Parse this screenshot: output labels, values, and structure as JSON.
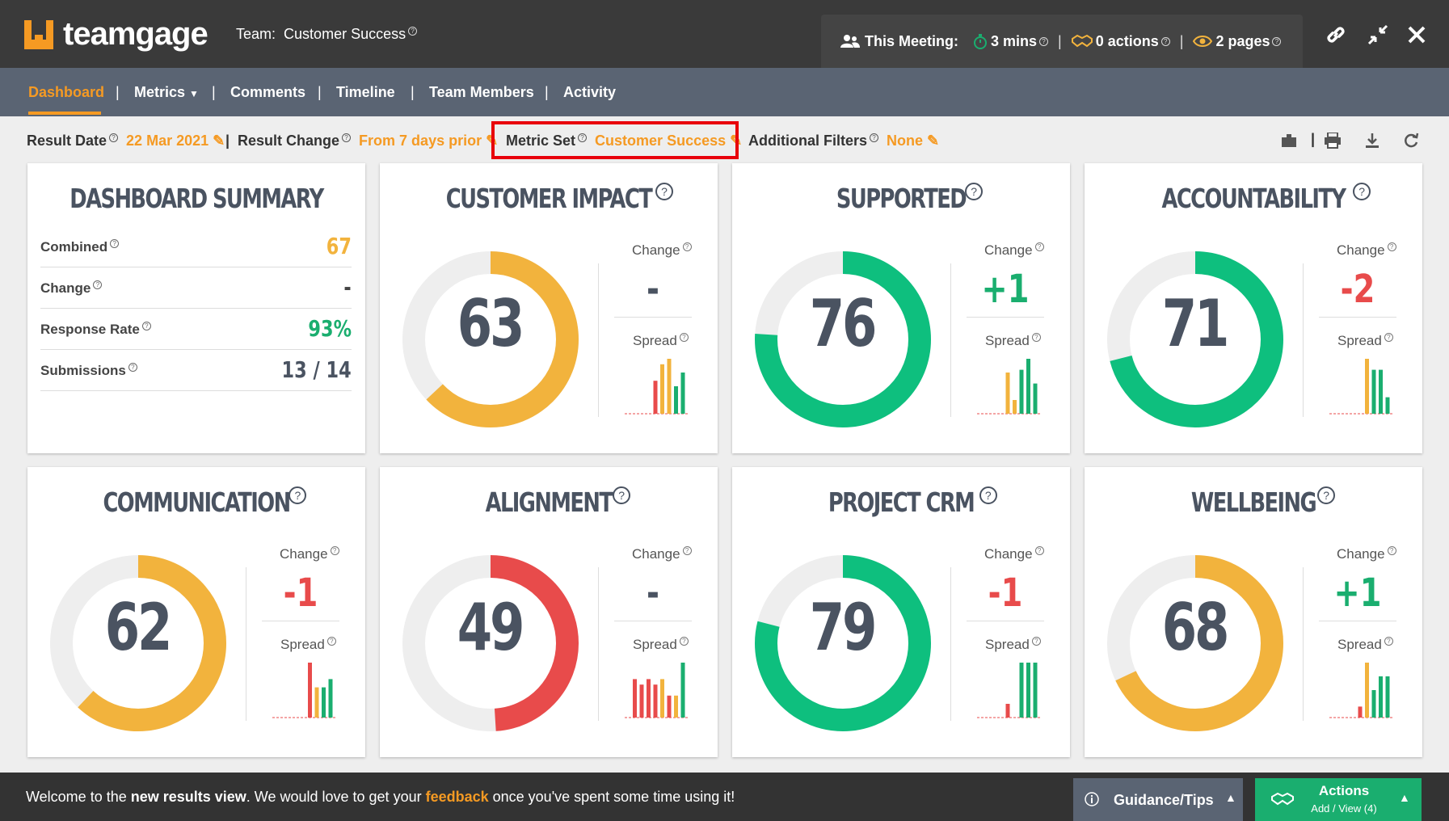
{
  "brand": {
    "name": "teamgage"
  },
  "team": {
    "label": "Team:",
    "name": "Customer Success"
  },
  "meeting": {
    "label": "This Meeting:",
    "time": "3 mins",
    "actions": "0 actions",
    "pages": "2 pages"
  },
  "nav": [
    "Dashboard",
    "Metrics",
    "Comments",
    "Timeline",
    "Team Members",
    "Activity"
  ],
  "filters": {
    "result_date_label": "Result Date",
    "result_date": "22 Mar 2021",
    "result_change_label": "Result Change",
    "result_change": "From 7 days prior",
    "metric_set_label": "Metric Set",
    "metric_set": "Customer Success",
    "additional_filters_label": "Additional Filters",
    "additional_filters": "None"
  },
  "summary": {
    "title": "DASHBOARD SUMMARY",
    "rows": [
      {
        "label": "Combined",
        "value": "67",
        "color": "#f2b33d"
      },
      {
        "label": "Change",
        "value": "-",
        "color": "#444444"
      },
      {
        "label": "Response Rate",
        "value": "93%",
        "color": "#1aae6f"
      },
      {
        "label": "Submissions",
        "value": "13 / 14",
        "color": "#4a5361"
      }
    ]
  },
  "labels": {
    "change": "Change",
    "spread": "Spread"
  },
  "metrics": [
    {
      "title": "CUSTOMER IMPACT",
      "score": "63",
      "change": "-",
      "change_color": "#4a5361",
      "ring_color": "#f2b33d",
      "fraction": 0.63,
      "spread": [
        {
          "v": 0.0,
          "c": "#e84b4b"
        },
        {
          "v": 0.0,
          "c": "#e84b4b"
        },
        {
          "v": 0.0,
          "c": "#e84b4b"
        },
        {
          "v": 0.6,
          "c": "#e84b4b"
        },
        {
          "v": 0.9,
          "c": "#f2b33d"
        },
        {
          "v": 1.0,
          "c": "#f2b33d"
        },
        {
          "v": 0.5,
          "c": "#1aae6f"
        },
        {
          "v": 0.75,
          "c": "#1aae6f"
        }
      ]
    },
    {
      "title": "SUPPORTED",
      "score": "76",
      "change": "+1",
      "change_color": "#1aae6f",
      "ring_color": "#0ebf7e",
      "fraction": 0.76,
      "spread": [
        {
          "v": 0.0,
          "c": "#e84b4b"
        },
        {
          "v": 0.0,
          "c": "#e84b4b"
        },
        {
          "v": 0.0,
          "c": "#e84b4b"
        },
        {
          "v": 0.0,
          "c": "#e84b4b"
        },
        {
          "v": 0.75,
          "c": "#f2b33d"
        },
        {
          "v": 0.25,
          "c": "#f2b33d"
        },
        {
          "v": 0.8,
          "c": "#1aae6f"
        },
        {
          "v": 1.0,
          "c": "#1aae6f"
        },
        {
          "v": 0.55,
          "c": "#1aae6f"
        }
      ]
    },
    {
      "title": "ACCOUNTABILITY",
      "score": "71",
      "change": "-2",
      "change_color": "#e84b4b",
      "ring_color": "#0ebf7e",
      "fraction": 0.71,
      "spread": [
        {
          "v": 0.0,
          "c": "#e84b4b"
        },
        {
          "v": 0.0,
          "c": "#e84b4b"
        },
        {
          "v": 0.0,
          "c": "#e84b4b"
        },
        {
          "v": 0.0,
          "c": "#e84b4b"
        },
        {
          "v": 1.0,
          "c": "#f2b33d"
        },
        {
          "v": 0.8,
          "c": "#1aae6f"
        },
        {
          "v": 0.8,
          "c": "#1aae6f"
        },
        {
          "v": 0.3,
          "c": "#1aae6f"
        }
      ]
    },
    {
      "title": "COMMUNICATION",
      "score": "62",
      "change": "-1",
      "change_color": "#e84b4b",
      "ring_color": "#f2b33d",
      "fraction": 0.62,
      "spread": [
        {
          "v": 0.0,
          "c": "#e84b4b"
        },
        {
          "v": 0.0,
          "c": "#e84b4b"
        },
        {
          "v": 0.0,
          "c": "#e84b4b"
        },
        {
          "v": 0.0,
          "c": "#e84b4b"
        },
        {
          "v": 1.0,
          "c": "#e84b4b"
        },
        {
          "v": 0.55,
          "c": "#f2b33d"
        },
        {
          "v": 0.55,
          "c": "#1aae6f"
        },
        {
          "v": 0.7,
          "c": "#1aae6f"
        }
      ]
    },
    {
      "title": "ALIGNMENT",
      "score": "49",
      "change": "-",
      "change_color": "#4a5361",
      "ring_color": "#e84b4b",
      "fraction": 0.49,
      "spread": [
        {
          "v": 0.7,
          "c": "#e84b4b"
        },
        {
          "v": 0.6,
          "c": "#e84b4b"
        },
        {
          "v": 0.7,
          "c": "#e84b4b"
        },
        {
          "v": 0.6,
          "c": "#e84b4b"
        },
        {
          "v": 0.7,
          "c": "#f2b33d"
        },
        {
          "v": 0.4,
          "c": "#e84b4b"
        },
        {
          "v": 0.4,
          "c": "#f2b33d"
        },
        {
          "v": 1.0,
          "c": "#1aae6f"
        }
      ]
    },
    {
      "title": "PROJECT CRM",
      "score": "79",
      "change": "-1",
      "change_color": "#e84b4b",
      "ring_color": "#0ebf7e",
      "fraction": 0.79,
      "spread": [
        {
          "v": 0.0,
          "c": "#e84b4b"
        },
        {
          "v": 0.0,
          "c": "#e84b4b"
        },
        {
          "v": 0.0,
          "c": "#e84b4b"
        },
        {
          "v": 0.0,
          "c": "#e84b4b"
        },
        {
          "v": 0.25,
          "c": "#e84b4b"
        },
        {
          "v": 0.0,
          "c": "#f2b33d"
        },
        {
          "v": 1.0,
          "c": "#1aae6f"
        },
        {
          "v": 1.0,
          "c": "#1aae6f"
        },
        {
          "v": 1.0,
          "c": "#1aae6f"
        }
      ]
    },
    {
      "title": "WELLBEING",
      "score": "68",
      "change": "+1",
      "change_color": "#1aae6f",
      "ring_color": "#f2b33d",
      "fraction": 0.68,
      "spread": [
        {
          "v": 0.0,
          "c": "#e84b4b"
        },
        {
          "v": 0.0,
          "c": "#e84b4b"
        },
        {
          "v": 0.0,
          "c": "#e84b4b"
        },
        {
          "v": 0.2,
          "c": "#e84b4b"
        },
        {
          "v": 1.0,
          "c": "#f2b33d"
        },
        {
          "v": 0.5,
          "c": "#1aae6f"
        },
        {
          "v": 0.75,
          "c": "#1aae6f"
        },
        {
          "v": 0.75,
          "c": "#1aae6f"
        }
      ]
    }
  ],
  "bottom": {
    "msg_pre": "Welcome to the ",
    "msg_bold": "new results view",
    "msg_mid": ". We would love to get your ",
    "msg_link": "feedback",
    "msg_post": " once you've spent some time using it!",
    "guidance": "Guidance/Tips",
    "actions_title": "Actions",
    "actions_sub": "Add / View (4)"
  },
  "colors": {
    "accent": "#f59a23",
    "green": "#1aae6f",
    "red": "#e84b4b",
    "amber": "#f2b33d"
  }
}
